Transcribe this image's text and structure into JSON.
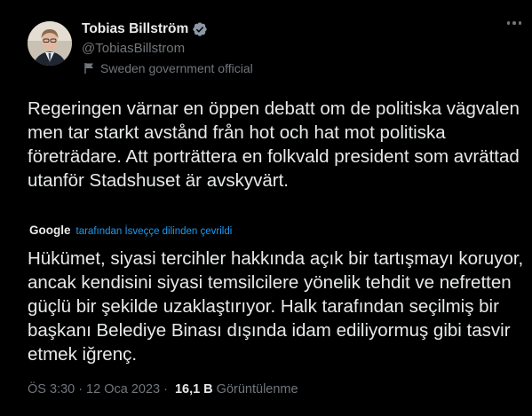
{
  "author": {
    "name": "Tobias Billström",
    "handle": "@TobiasBillstrom",
    "label": "Sweden government official",
    "verified_color": "#8b98a5"
  },
  "tweet": {
    "text": "Regeringen värnar en öppen debatt om de politiska vägvalen men tar starkt avstånd från hot och hat mot politiska företrädare. Att porträttera en folkvald president som avrättad utanför Stadshuset är avskyvärt.",
    "translation_provider": "Google",
    "translation_note": "tarafından İsveççe dilinden çevrildi",
    "translated_text": "Hükümet, siyasi tercihler hakkında açık bir tartışmayı koruyor, ancak kendisini siyasi temsilcilere yönelik tehdit ve nefretten güçlü bir şekilde uzaklaştırıyor. Halk tarafından seçilmiş bir başkanı Belediye Binası dışında idam ediliyormuş gibi tasvir etmek iğrenç."
  },
  "meta": {
    "time": "ÖS 3:30",
    "separator": "·",
    "date": "12 Oca 2023",
    "views_count": "16,1 B",
    "views_label": "Görüntülenme"
  },
  "icons": {
    "verified": "verified-badge-icon",
    "flag": "government-flag-icon",
    "more": "more-options-icon"
  }
}
